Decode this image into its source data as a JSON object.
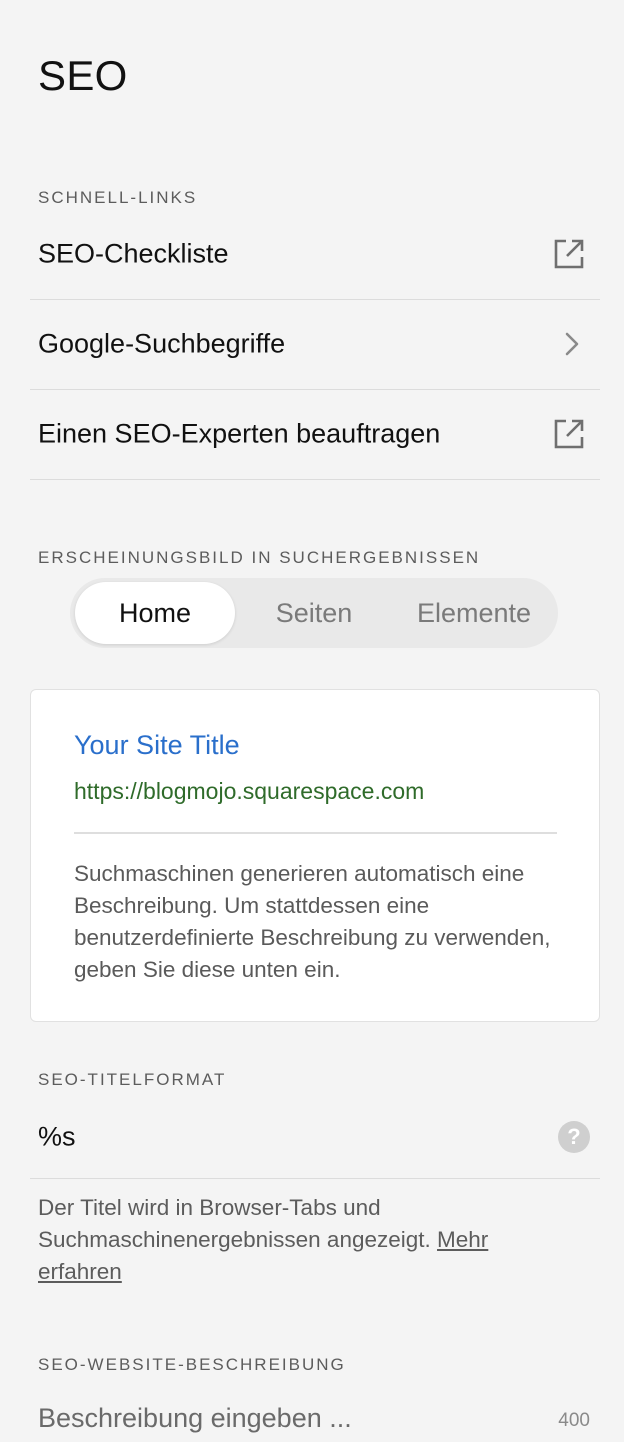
{
  "page": {
    "title": "SEO"
  },
  "quick_links": {
    "label": "SCHNELL-LINKS",
    "items": [
      {
        "label": "SEO-Checkliste",
        "icon": "external-link-icon"
      },
      {
        "label": "Google-Suchbegriffe",
        "icon": "chevron-right-icon"
      },
      {
        "label": "Einen SEO-Experten beauftragen",
        "icon": "external-link-icon"
      }
    ]
  },
  "appearance": {
    "label": "ERSCHEINUNGSBILD IN SUCHERGEBNISSEN",
    "tabs": [
      {
        "label": "Home",
        "active": true
      },
      {
        "label": "Seiten",
        "active": false
      },
      {
        "label": "Elemente",
        "active": false
      }
    ],
    "preview": {
      "title": "Your Site Title",
      "url": "https://blogmojo.squarespace.com",
      "description": "Suchmaschinen generieren automatisch eine Beschreibung. Um stattdessen eine benutzerdefinierte Beschreibung zu verwenden, geben Sie diese unten ein."
    }
  },
  "title_format": {
    "label": "SEO-TITELFORMAT",
    "value": "%s",
    "help_icon": "question-mark-icon",
    "help_text": "Der Titel wird in Browser-Tabs und Suchmaschinenergebnissen angezeigt.",
    "more_link": "Mehr erfahren"
  },
  "site_description": {
    "label": "SEO-WEBSITE-BESCHREIBUNG",
    "placeholder": "Beschreibung eingeben ...",
    "char_limit": "400"
  },
  "colors": {
    "panel_bg": "#f4f4f4",
    "preview_title": "#2a6fcb",
    "preview_url": "#2f6b2a"
  }
}
